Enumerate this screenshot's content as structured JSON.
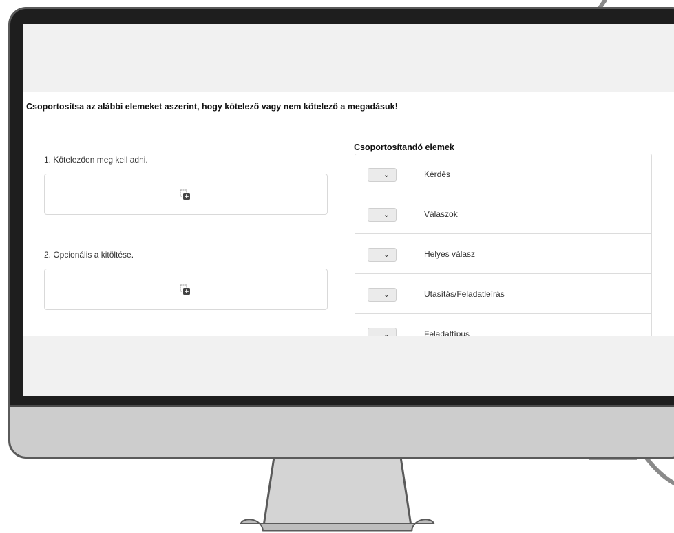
{
  "task": {
    "instruction": "Csoportosítsa az alábbi elemeket aszerint, hogy kötelező vagy nem kötelező a megadásuk!"
  },
  "groups": [
    {
      "label": "1. Kötelezően meg kell adni."
    },
    {
      "label": "2. Opcionális a kitöltése."
    }
  ],
  "items_panel": {
    "title": "Csoportosítandó elemek",
    "items": [
      {
        "label": "Kérdés"
      },
      {
        "label": "Válaszok"
      },
      {
        "label": "Helyes válasz"
      },
      {
        "label": "Utasítás/Feladatleírás"
      },
      {
        "label": "Feladattípus"
      }
    ]
  },
  "icons": {
    "drop_zone_icon": "add-to-group-icon",
    "select_chevron": "chevron-down-icon"
  },
  "colors": {
    "bezel": "#1e1e1e",
    "chin": "#cdcdcd",
    "screen_band": "#f1f1f1",
    "border": "#dcdcdc"
  }
}
